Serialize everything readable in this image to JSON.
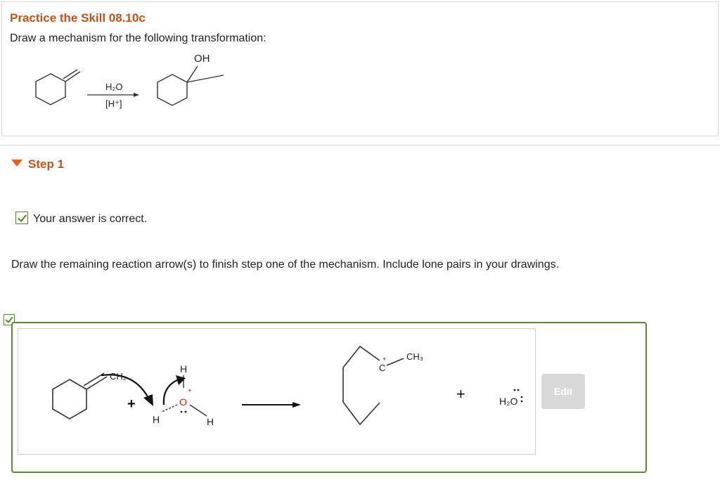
{
  "header": {
    "title": "Practice the Skill 08.10c",
    "prompt": "Draw a mechanism for the following transformation:"
  },
  "reaction": {
    "reagent_top": "H₂O",
    "reagent_bottom": "[H⁺]",
    "product_group": "OH"
  },
  "step": {
    "label": "Step 1",
    "status_text": "Your answer is correct.",
    "instruction": "Draw the remaining reaction arrow(s) to finish step one of the mechanism. Include lone pairs in your drawings."
  },
  "mechanism": {
    "ch2_label": "CH₂",
    "ch3_label": "CH₃",
    "plus": "+",
    "h_label": "H",
    "o_label": "O",
    "c_label": "C",
    "water_label": "H₂O"
  },
  "edit_button": {
    "label": "Edit"
  },
  "colors": {
    "title": "#c4501a",
    "frame_border": "#5a8a2e",
    "charge_red": "#d62020",
    "edit_button_bg": "#d9d9d9"
  }
}
